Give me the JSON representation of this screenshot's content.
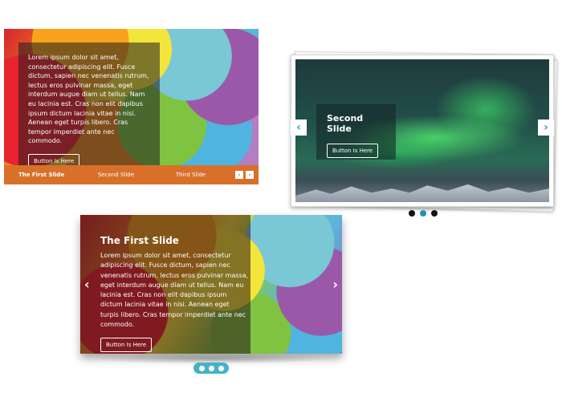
{
  "slider1": {
    "caption_text": "Lorem ipsum dolor sit amet, consectetur adipiscing elit. Fusce dictum, sapien nec venenatis rutrum, lectus eros pulvinar massa, eget interdum augue diam ut tellus. Nam eu lacinia est. Cras non elit dapibus ipsum dictum lacinia vitae in nisi. Aenean eget turpis libero. Cras tempor imperdiet ante nec commodo.",
    "button_label": "Button Is Here",
    "tabs": [
      {
        "label": "The First Slide",
        "active": true
      },
      {
        "label": "Second Slide",
        "active": false
      },
      {
        "label": "Third Slide",
        "active": false
      }
    ],
    "prev_label": "‹",
    "next_label": "›",
    "tabbar_color": "#d9702a"
  },
  "slider2": {
    "caption_title": "Second Slide",
    "button_label": "Button Is Here",
    "prev_label": "‹",
    "next_label": "›",
    "dots": [
      {
        "active": false
      },
      {
        "active": true
      },
      {
        "active": false
      }
    ],
    "accent_color": "#2a8fae"
  },
  "slider3": {
    "caption_title": "The First Slide",
    "caption_text": "Lorem ipsum dolor sit amet, consectetur adipiscing elit. Fusce dictum, sapien nec venenatis rutrum, lectus eros pulvinar massa, eget interdum augue diam ut tellus. Nam eu lacinia est. Cras non elit dapibus ipsum dictum lacinia vitae in nisi. Aenean eget turpis libero. Cras tempor imperdiet ante nec commodo.",
    "button_label": "Button Is Here",
    "prev_label": "‹",
    "next_label": "›",
    "dots_count": 3,
    "dots_bg_color": "#47b2c7"
  }
}
